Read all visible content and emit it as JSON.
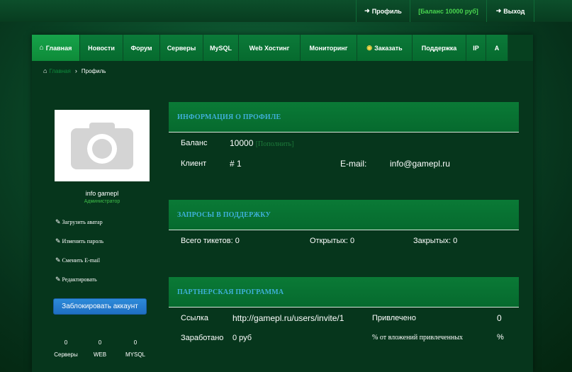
{
  "topbar": {
    "profile_label": "Профиль",
    "balance_label": "[Баланс 10000 руб]",
    "logout_label": "Выход"
  },
  "nav": {
    "items": [
      {
        "label": "Главная",
        "icon": "home-icon"
      },
      {
        "label": "Новости"
      },
      {
        "label": "Форум"
      },
      {
        "label": "Серверы"
      },
      {
        "label": "MySQL"
      },
      {
        "label": "Web Хостинг"
      },
      {
        "label": "Мониторинг"
      },
      {
        "label": "Заказать",
        "icon": "gamepad-icon"
      },
      {
        "label": "Поддержка"
      },
      {
        "label": "IP"
      },
      {
        "label": "A"
      }
    ]
  },
  "breadcrumb": {
    "home": "Главная",
    "current": "Профиль"
  },
  "user": {
    "name": "info gamepl",
    "role": "Администратор"
  },
  "side_links": {
    "upload_avatar": "Загрузить аватар",
    "change_password": "Изменить пароль",
    "change_email": "Сменить E-mail",
    "edit": "Редактировать"
  },
  "block_button": "Заблокировать аккаунт",
  "stats": [
    {
      "value": "0",
      "label": "Серверы"
    },
    {
      "value": "0",
      "label": "WEB"
    },
    {
      "value": "0",
      "label": "MYSQL"
    }
  ],
  "profile_info": {
    "title": "ИНФОРМАЦИЯ О ПРОФИЛЕ",
    "balance_label": "Баланс",
    "balance_value": "10000",
    "topup_link": "[Пополнить]",
    "client_label": "Клиент",
    "client_value": "# 1",
    "email_label": "E-mail:",
    "email_value": "info@gamepl.ru"
  },
  "support": {
    "title": "ЗАПРОСЫ В ПОДДЕРЖКУ",
    "total": "Всего тикетов: 0",
    "open": "Открытых: 0",
    "closed": "Закрытых: 0"
  },
  "partner": {
    "title": "ПАРТНЕРСКАЯ ПРОГРАММА",
    "link_label": "Ссылка",
    "link_value": "http://gamepl.ru/users/invite/1",
    "invited_label": "Привлечено",
    "invited_value": "0",
    "earned_label": "Заработано",
    "earned_value": "0 руб",
    "percent_label": "% от вложений привлеченных",
    "percent_value": "%"
  },
  "colors": {
    "accent_green": "#0b7a39",
    "balance_green": "#49d44f",
    "header_blue": "#3fb0d9",
    "button_blue": "#2d8ad9"
  }
}
